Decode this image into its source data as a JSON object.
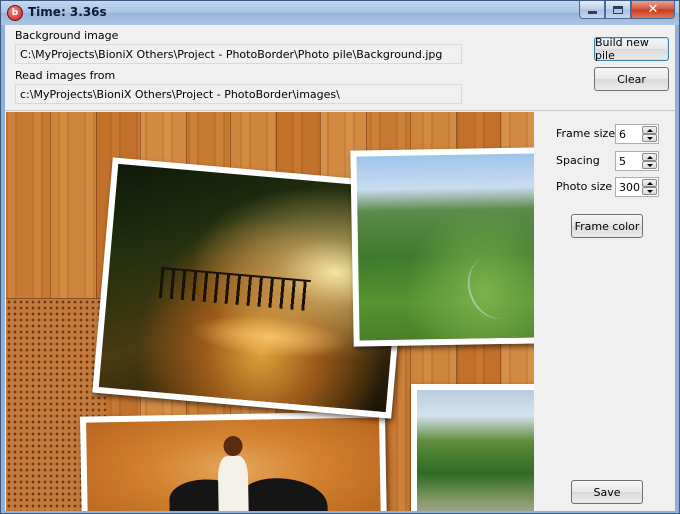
{
  "window": {
    "title": "Time: 3.36s",
    "app_icon": "bionix-red-circle-icon",
    "caption_buttons": [
      "minimize-icon",
      "maximize-icon",
      "close-icon"
    ]
  },
  "paths": {
    "background_label": "Background image",
    "background_value": "C:\\MyProjects\\BioniX Others\\Project - PhotoBorder\\Photo pile\\Background.jpg",
    "images_label": "Read images from",
    "images_value": "c:\\MyProjects\\BioniX Others\\Project - PhotoBorder\\images\\"
  },
  "actions": {
    "build_label": "Build new pile",
    "clear_label": "Clear"
  },
  "settings": {
    "frame_size_label": "Frame size",
    "frame_size_value": "6",
    "spacing_label": "Spacing",
    "spacing_value": "5",
    "photo_size_label": "Photo size",
    "photo_size_value": "300",
    "frame_color_label": "Frame color",
    "save_label": "Save"
  },
  "colors": {
    "accent_button_border": "#3c7fb1",
    "frame": "#ffffff",
    "wood": "#c97a32"
  }
}
